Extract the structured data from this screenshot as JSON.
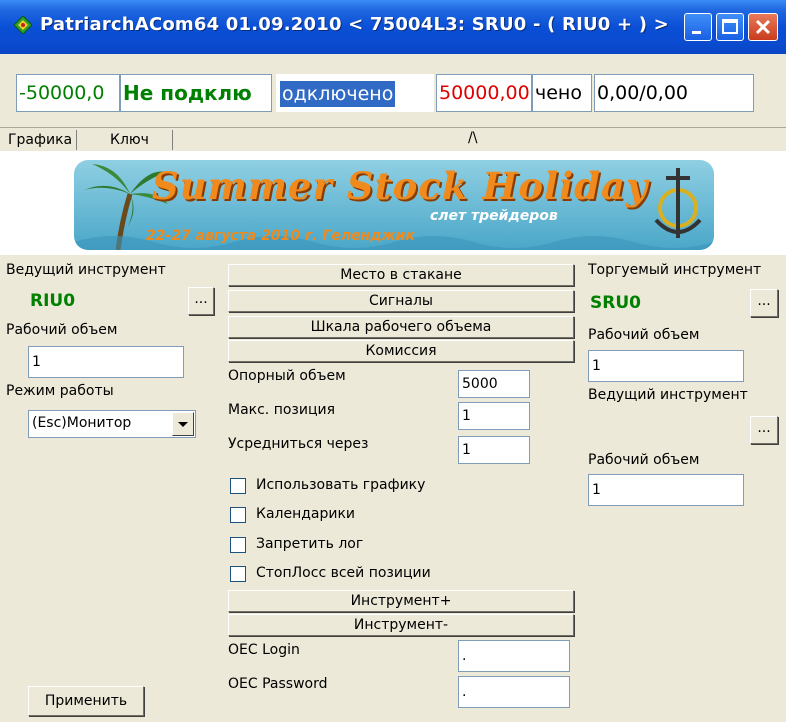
{
  "window": {
    "title": "PatriarchACom64 01.09.2010   < 75004L3: SRU0 - ( RIU0 +  ) >"
  },
  "status_fields": [
    {
      "text": "-50000,0",
      "color": "#008000"
    },
    {
      "text": "Не подклю",
      "color": "#008000"
    },
    {
      "text": "одключено",
      "color": "#ffffff"
    },
    {
      "text": "50000,00",
      "color": "#e00000"
    },
    {
      "text": "чено",
      "color": "#000000"
    },
    {
      "text": "0,00/0,00",
      "color": "#000000"
    }
  ],
  "tabs": [
    {
      "label": "Графика"
    },
    {
      "label": "Ключ"
    }
  ],
  "tab_marker": "/\\",
  "banner": {
    "title": "Summer Stock Holiday",
    "subtitle": "слет трейдеров",
    "date": "22-27 августа 2010 г. Геленджик"
  },
  "left_panel": {
    "lead_label": "Ведущий инструмент",
    "lead_value": "RIU0",
    "browse": "...",
    "volume_label": "Рабочий объем",
    "volume_value": "1",
    "mode_label": "Режим работы",
    "mode_value": "(Esc)Монитор",
    "apply": "Применить"
  },
  "center_panel": {
    "buttons": [
      "Место в стакане",
      "Сигналы",
      "Шкала рабочего объема",
      "Комиссия"
    ],
    "base_volume_label": "Опорный объем",
    "base_volume_value": "5000",
    "max_position_label": "Макс. позиция",
    "max_position_value": "1",
    "average_label": "Усредниться через",
    "average_value": "1",
    "checkboxes": [
      "Использовать графику",
      "Календарики",
      "Запретить лог",
      "СтопЛосс всей позиции"
    ],
    "instrument_plus": "Инструмент+",
    "instrument_minus": "Инструмент-",
    "login_label": "OEC Login",
    "login_value": ".",
    "password_label": "OEC Password",
    "password_value": "."
  },
  "right_panel": {
    "traded_label": "Торгуемый инструмент",
    "traded_value": "SRU0",
    "browse": "...",
    "volume_label": "Рабочий объем",
    "volume_value": "1",
    "lead_label": "Ведущий инструмент",
    "browse2": "...",
    "volume2_label": "Рабочий объем",
    "volume2_value": "1"
  }
}
